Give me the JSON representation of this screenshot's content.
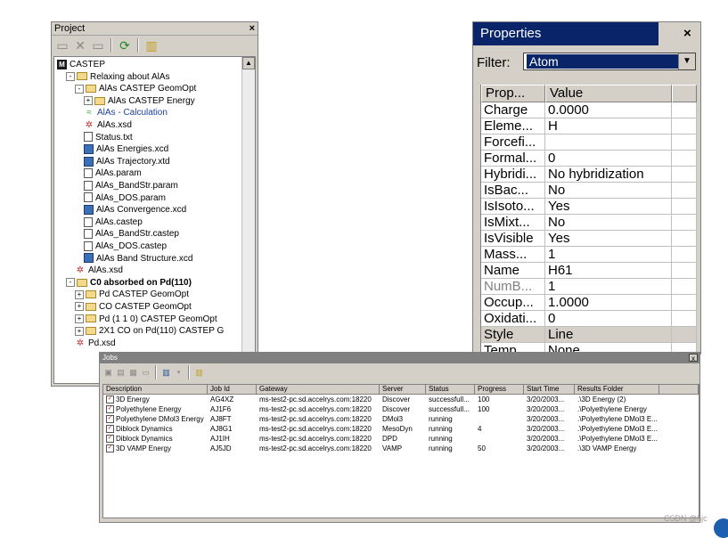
{
  "project": {
    "title": "Project",
    "close": "×",
    "tree": [
      {
        "label": "CASTEP",
        "icon": "root",
        "depth": 0
      },
      {
        "label": "Relaxing about AlAs",
        "icon": "folder",
        "depth": 1,
        "exp": "-"
      },
      {
        "label": "AlAs CASTEP GeomOpt",
        "icon": "folder",
        "depth": 2,
        "exp": "-"
      },
      {
        "label": "AlAs CASTEP Energy",
        "icon": "folder",
        "depth": 3,
        "exp": "+"
      },
      {
        "label": "AlAs - Calculation",
        "icon": "calc",
        "depth": 3,
        "link": true
      },
      {
        "label": "AlAs.xsd",
        "icon": "mol",
        "depth": 3
      },
      {
        "label": "Status.txt",
        "icon": "doc",
        "depth": 3
      },
      {
        "label": "AlAs Energies.xcd",
        "icon": "chart",
        "depth": 3
      },
      {
        "label": "AlAs Trajectory.xtd",
        "icon": "chart",
        "depth": 3
      },
      {
        "label": "AlAs.param",
        "icon": "doc",
        "depth": 3
      },
      {
        "label": "AlAs_BandStr.param",
        "icon": "doc",
        "depth": 3
      },
      {
        "label": "AlAs_DOS.param",
        "icon": "doc",
        "depth": 3
      },
      {
        "label": "AlAs Convergence.xcd",
        "icon": "chart",
        "depth": 3
      },
      {
        "label": "AlAs.castep",
        "icon": "doc",
        "depth": 3
      },
      {
        "label": "AlAs_BandStr.castep",
        "icon": "doc",
        "depth": 3
      },
      {
        "label": "AlAs_DOS.castep",
        "icon": "doc",
        "depth": 3
      },
      {
        "label": "AlAs Band Structure.xcd",
        "icon": "chart",
        "depth": 3
      },
      {
        "label": "AlAs.xsd",
        "icon": "mol",
        "depth": 2
      },
      {
        "label": "C0 absorbed on Pd(110)",
        "icon": "folder",
        "depth": 1,
        "exp": "-",
        "bold": true
      },
      {
        "label": "Pd CASTEP GeomOpt",
        "icon": "folder",
        "depth": 2,
        "exp": "+"
      },
      {
        "label": "CO CASTEP GeomOpt",
        "icon": "folder",
        "depth": 2,
        "exp": "+"
      },
      {
        "label": "Pd (1 1 0) CASTEP GeomOpt",
        "icon": "folder",
        "depth": 2,
        "exp": "+"
      },
      {
        "label": "2X1 CO on  Pd(110) CASTEP G",
        "icon": "folder",
        "depth": 2,
        "exp": "+"
      },
      {
        "label": "Pd.xsd",
        "icon": "mol",
        "depth": 2
      }
    ]
  },
  "properties": {
    "title": "Properties",
    "close": "×",
    "filter_label": "Filter:",
    "filter_value": "Atom",
    "headers": [
      "Prop...",
      "Value"
    ],
    "rows": [
      {
        "prop": "Charge",
        "value": "0.0000"
      },
      {
        "prop": "Eleme...",
        "value": "H"
      },
      {
        "prop": "Forcefi...",
        "value": ""
      },
      {
        "prop": "Formal...",
        "value": "0"
      },
      {
        "prop": "Hybridi...",
        "value": "No hybridization"
      },
      {
        "prop": "IsBac...",
        "value": "No"
      },
      {
        "prop": "IsIsoto...",
        "value": "Yes"
      },
      {
        "prop": "IsMixt...",
        "value": "No"
      },
      {
        "prop": "IsVisible",
        "value": "Yes"
      },
      {
        "prop": "Mass...",
        "value": "1"
      },
      {
        "prop": "Name",
        "value": "H61"
      },
      {
        "prop": "NumB...",
        "value": "1",
        "dim": true
      },
      {
        "prop": "Occup...",
        "value": "1.0000"
      },
      {
        "prop": "Oxidati...",
        "value": "0"
      },
      {
        "prop": "Style",
        "value": "Line",
        "selected": true
      },
      {
        "prop": "Temp...",
        "value": "None"
      }
    ]
  },
  "jobs": {
    "title": "Jobs",
    "close": "x",
    "headers": [
      "Description",
      "Job Id",
      "Gateway",
      "Server",
      "Status",
      "Progress",
      "Start Time",
      "Results Folder",
      ""
    ],
    "rows": [
      [
        "3D Energy",
        "AG4XZ",
        "ms-test2-pc.sd.accelrys.com:18220",
        "Discover",
        "successfull...",
        "100",
        "3/20/2003...",
        ".\\3D Energy (2)"
      ],
      [
        "Polyethylene Energy",
        "AJ1F6",
        "ms-test2-pc.sd.accelrys.com:18220",
        "Discover",
        "successfull...",
        "100",
        "3/20/2003...",
        ".\\Polyethylene Energy"
      ],
      [
        "Polyethylene DMol3 Energy",
        "AJ8FT",
        "ms-test2-pc.sd.accelrys.com:18220",
        "DMol3",
        "running",
        "",
        "3/20/2003...",
        ".\\Polyethylene DMol3 E..."
      ],
      [
        "Diblock Dynamics",
        "AJ8G1",
        "ms-test2-pc.sd.accelrys.com:18220",
        "MesoDyn",
        "running",
        "4",
        "3/20/2003...",
        ".\\Polyethylene DMol3 E..."
      ],
      [
        "Diblock Dynamics",
        "AJ1IH",
        "ms-test2-pc.sd.accelrys.com:18220",
        "DPD",
        "running",
        "",
        "3/20/2003...",
        ".\\Polyethylene DMol3 E..."
      ],
      [
        "3D VAMP Energy",
        "AJ5JD",
        "ms-test2-pc.sd.accelrys.com:18220",
        "VAMP",
        "running",
        "50",
        "3/20/2003...",
        ".\\3D VAMP Energy"
      ]
    ]
  },
  "watermark": "CSDN @hjc"
}
